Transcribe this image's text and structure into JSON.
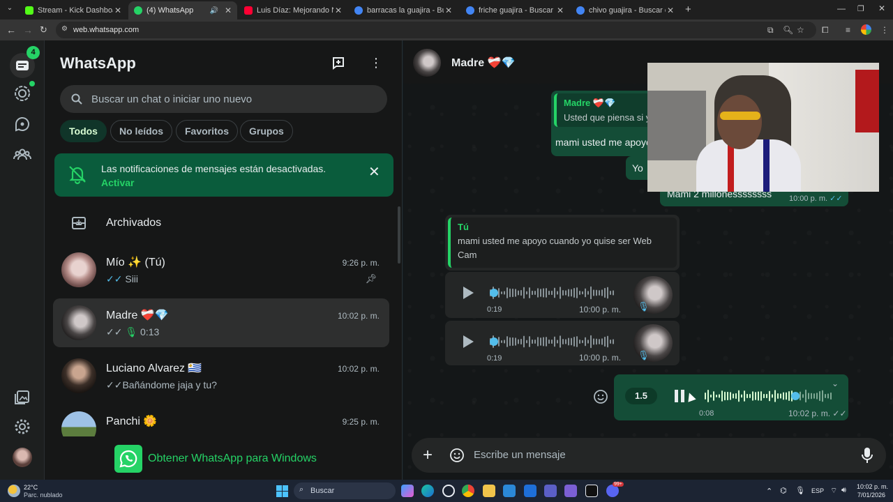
{
  "browser": {
    "tabs": [
      {
        "title": "Stream - Kick Dashboard",
        "favicon_color": "#53fc18"
      },
      {
        "title": "(4) WhatsApp",
        "favicon_color": "#25d366"
      },
      {
        "title": "Luis Díaz: Mejorando Nuestro I",
        "favicon_color": "#ff0033"
      },
      {
        "title": "barracas la guajira - Buscar con",
        "favicon_color": "#4285f4"
      },
      {
        "title": "friche guajira - Buscar con Goo",
        "favicon_color": "#4285f4"
      },
      {
        "title": "chivo guajira - Buscar con Goo",
        "favicon_color": "#4285f4"
      }
    ],
    "url": "web.whatsapp.com"
  },
  "rail": {
    "unread_badge": "4"
  },
  "sidebar": {
    "title": "WhatsApp",
    "search_placeholder": "Buscar un chat o iniciar uno nuevo",
    "filters": [
      "Todos",
      "No leídos",
      "Favoritos",
      "Grupos"
    ],
    "notice": {
      "text": "Las notificaciones de mensajes están desactivadas.",
      "action": "Activar"
    },
    "archived_label": "Archivados",
    "chats": [
      {
        "name": "Mío ✨ (Tú)",
        "time": "9:26 p. m.",
        "preview": "Siii",
        "ticks": "✓✓"
      },
      {
        "name": "Madre ❤️‍🩹💎",
        "time": "10:02 p. m.",
        "preview": "0:13",
        "ticks": "✓✓"
      },
      {
        "name": "Luciano Alvarez 🇺🇾",
        "time": "10:02 p. m.",
        "preview": "Bañándome jaja y tu?",
        "ticks": "✓✓"
      },
      {
        "name": "Panchi 🌼",
        "time": "9:25 p. m.",
        "preview": "",
        "ticks": ""
      }
    ],
    "get_app": "Obtener WhatsApp para Windows"
  },
  "conversation": {
    "contact": "Madre ❤️‍🩹💎",
    "messages": {
      "m1_quote_who": "Madre ❤️‍🩹💎",
      "m1_quote_text": "Usted que piensa si y",
      "m1_text": "mami usted me apoyo",
      "m2_text": "Yo",
      "m3_text": "Mami 2 millonessssssss",
      "m3_time": "10:00 p. m.",
      "m4_quote_who": "Tú",
      "m4_quote_text_1": "mami usted me apoyo cuando yo quise ser Web",
      "m4_quote_text_2": "Cam",
      "audio1_duration": "0:19",
      "audio1_time": "10:00 p. m.",
      "audio2_duration": "0:19",
      "audio2_time": "10:00 p. m.",
      "audio3_speed": "1.5",
      "audio3_elapsed": "0:08",
      "audio3_time": "10:02 p. m.",
      "audio3_progress": 0.7
    },
    "composer_placeholder": "Escribe un mensaje"
  },
  "taskbar": {
    "weather_temp": "22°C",
    "weather_desc": "Parc. nublado",
    "search_placeholder": "Buscar",
    "lang": "ESP",
    "clock_time": "10:02 p. m.",
    "clock_date": "7/01/2026",
    "notif_count": "99+"
  },
  "colors": {
    "accent": "#25d366",
    "outgoing_bubble": "#144d37",
    "incoming_bubble": "#242626"
  }
}
